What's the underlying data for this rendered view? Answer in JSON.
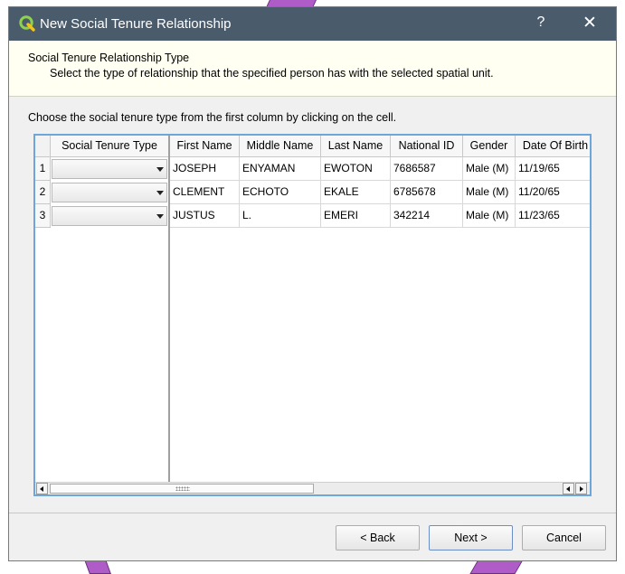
{
  "window": {
    "title": "New Social Tenure Relationship",
    "help_label": "?",
    "close_label": "✕"
  },
  "header": {
    "title": "Social Tenure Relationship Type",
    "subtitle": "Select the type of relationship that the specified person has with the selected spatial unit."
  },
  "instruction": "Choose the social tenure type from the first column by clicking on the cell.",
  "table": {
    "frozen_header": "Social Tenure Type",
    "columns": [
      "First Name",
      "Middle Name",
      "Last Name",
      "National ID",
      "Gender",
      "Date Of Birth"
    ],
    "row_numbers": [
      "1",
      "2",
      "3"
    ],
    "rows": [
      [
        "JOSEPH",
        "ENYAMAN",
        "EWOTON",
        "7686587",
        "Male (M)",
        "11/19/65"
      ],
      [
        "CLEMENT",
        "ECHOTO",
        "EKALE",
        "6785678",
        "Male (M)",
        "11/20/65"
      ],
      [
        "JUSTUS",
        "L.",
        "EMERI",
        "342214",
        "Male (M)",
        "11/23/65"
      ]
    ],
    "tenure_values": [
      "",
      "",
      ""
    ]
  },
  "buttons": {
    "back": "< Back",
    "next": "Next >",
    "cancel": "Cancel"
  },
  "colors": {
    "titlebar": "#4a5b6c",
    "header_panel": "#fffff2",
    "table_focus_border": "#6ea6dc",
    "background_shape": "#b05cc8"
  },
  "icons": {
    "app": "qgis-logo-icon",
    "combo": "dropdown-arrow-icon"
  }
}
